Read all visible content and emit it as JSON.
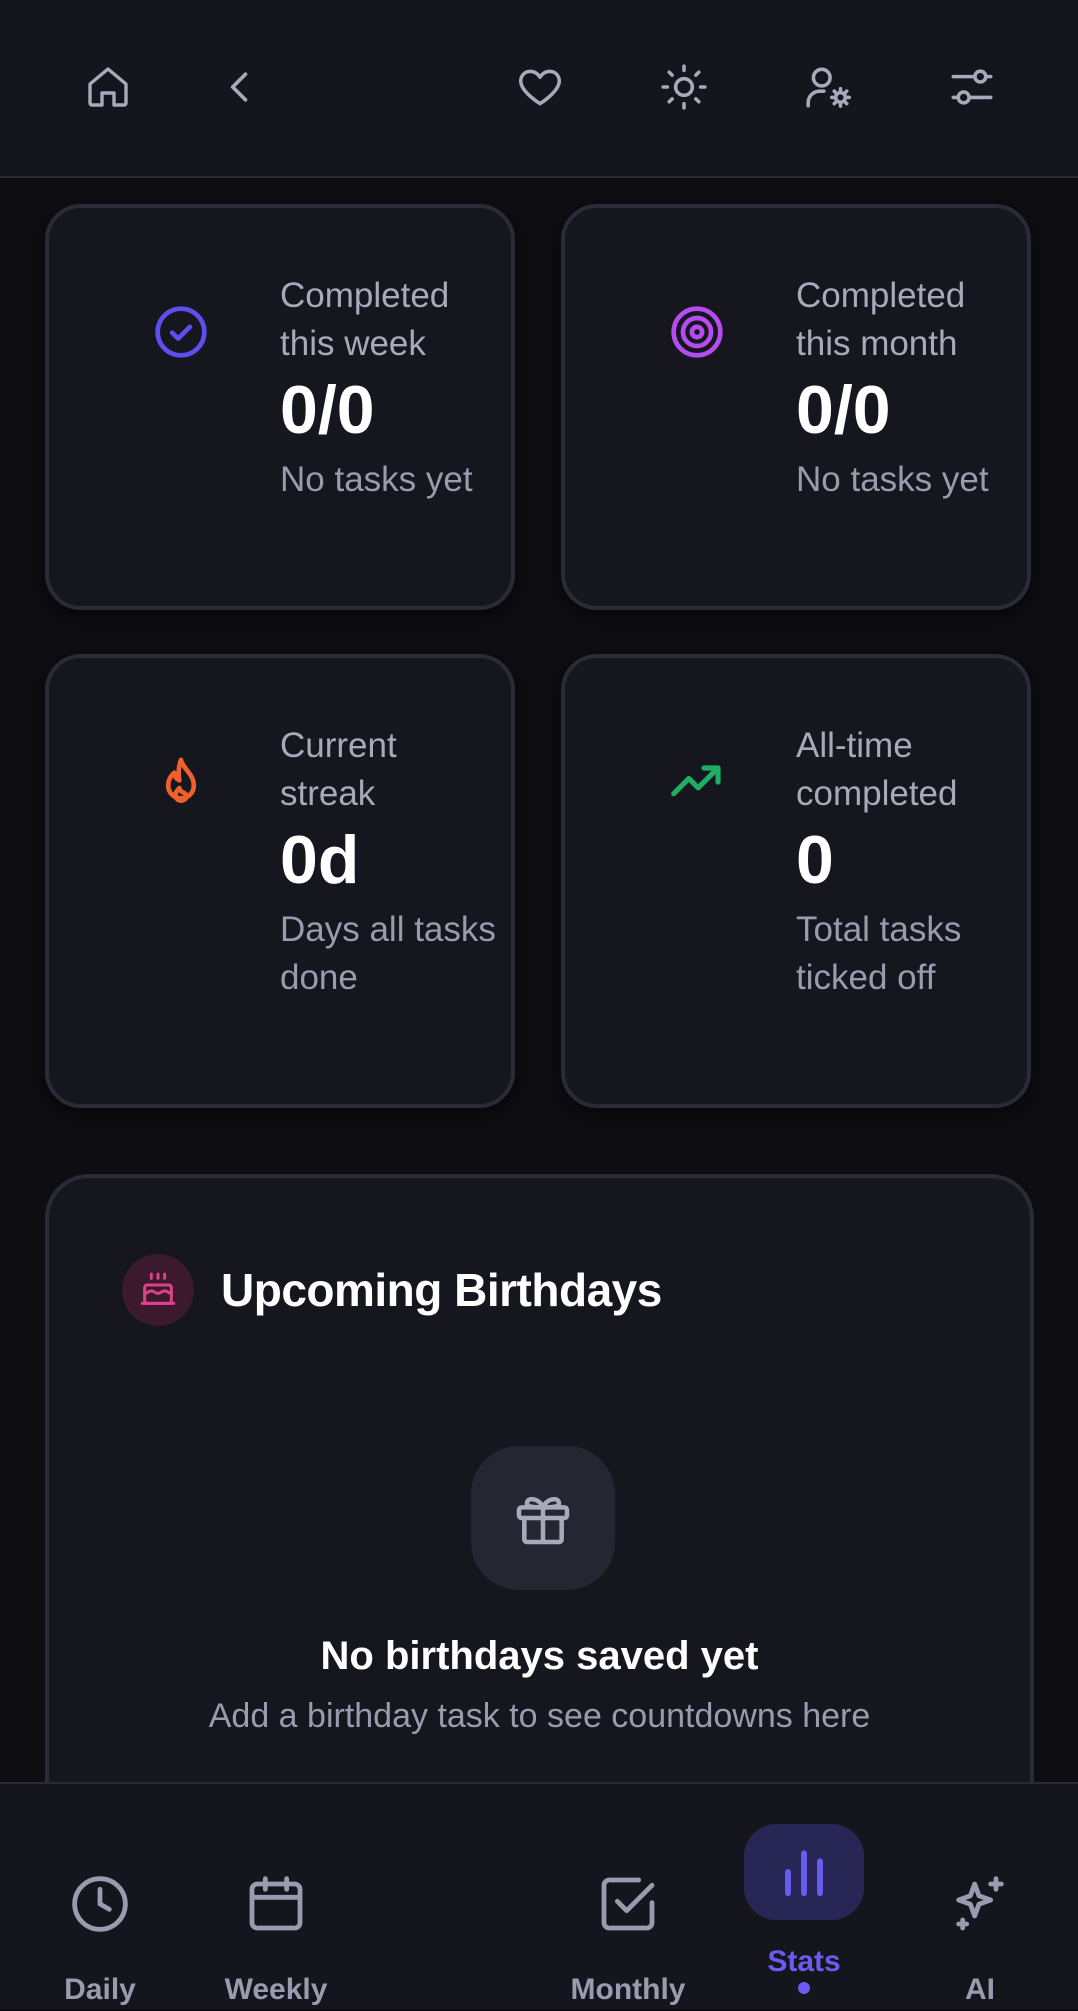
{
  "topbar": {
    "icons": [
      "home-icon",
      "back-chevron-icon",
      "heart-icon",
      "sun-icon",
      "user-settings-icon",
      "sliders-icon"
    ]
  },
  "stats": [
    {
      "id": "week",
      "title": "Completed this week",
      "value": "0/0",
      "sub": "No tasks yet",
      "icon": "check-circle-icon",
      "color": "#5b4ff0"
    },
    {
      "id": "month",
      "title": "Completed this month",
      "value": "0/0",
      "sub": "No tasks yet",
      "icon": "target-icon",
      "color": "#b44cf0"
    },
    {
      "id": "streak",
      "title": "Current streak",
      "value": "0d",
      "sub": "Days all tasks done",
      "icon": "flame-icon",
      "color": "#f0602e"
    },
    {
      "id": "alltime",
      "title": "All-time completed",
      "value": "0",
      "sub": "Total tasks ticked off",
      "icon": "trending-up-icon",
      "color": "#1fae66"
    }
  ],
  "birthdays": {
    "title": "Upcoming Birthdays",
    "icon": "cake-icon",
    "accent": "#e0408a",
    "empty_title": "No birthdays saved yet",
    "empty_sub": "Add a birthday task to see countdowns here"
  },
  "nav": {
    "items": [
      {
        "label": "Daily",
        "icon": "clock-icon"
      },
      {
        "label": "Weekly",
        "icon": "calendar-icon"
      },
      {
        "label": "Monthly",
        "icon": "checkbox-icon"
      },
      {
        "label": "Stats",
        "icon": "bar-chart-icon",
        "active": true
      },
      {
        "label": "AI",
        "icon": "sparkles-icon"
      }
    ],
    "active_color": "#6a5cf0"
  }
}
